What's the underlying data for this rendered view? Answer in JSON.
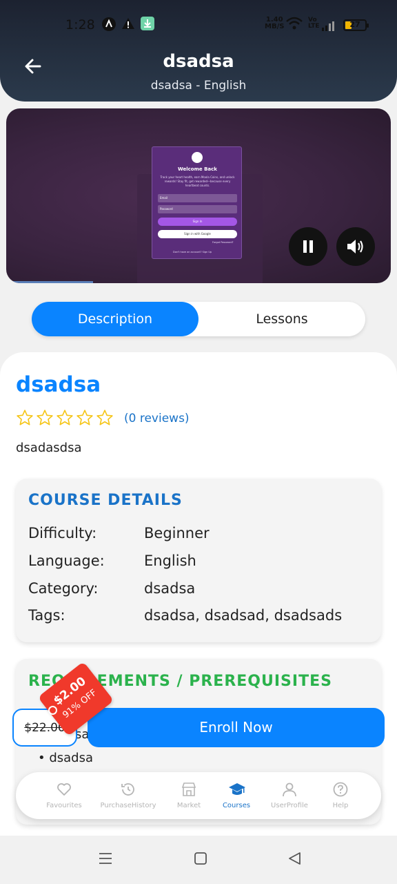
{
  "status_bar": {
    "time": "1:28",
    "net_speed_value": "1.40",
    "net_speed_unit": "MB/S",
    "volte_top": "Vo",
    "volte_bottom": "LTE",
    "battery": "27"
  },
  "header": {
    "title": "dsadsa",
    "subtitle": "dsadsa - English"
  },
  "video": {
    "modal_title": "Welcome Back",
    "modal_text": "Track your heart health, earn Moola Coins, and unlock rewards! Stay fit, get rewarded—because every heartbeat counts.",
    "email_placeholder": "Email",
    "password_placeholder": "Password",
    "sign_in": "Sign In",
    "google_sign_in": "Sign in with Google",
    "forgot": "Forgot Password?",
    "no_account": "Don't have an account?",
    "sign_up": "Sign Up"
  },
  "tabs": [
    {
      "label": "Description",
      "active": true
    },
    {
      "label": "Lessons",
      "active": false
    }
  ],
  "course": {
    "title": "dsadsa",
    "rating_stars": 0,
    "reviews": "(0 reviews)",
    "description": "dsadasdsa"
  },
  "details": {
    "heading": "COURSE DETAILS",
    "rows": [
      {
        "key": "Difficulty:",
        "value": "Beginner"
      },
      {
        "key": "Language:",
        "value": "English"
      },
      {
        "key": "Category:",
        "value": "dsadsa"
      },
      {
        "key": "Tags:",
        "value": "dsadsa, dsadsad, dsadsads"
      }
    ]
  },
  "requirements": {
    "heading": "REQUIREMENTS / PREREQUISITES",
    "partial_item": "sa",
    "item2": "• dsadsa"
  },
  "pricing": {
    "old_price": "$22.00",
    "new_price": "$2.00",
    "discount": "91% OFF",
    "enroll_label": "Enroll Now"
  },
  "bottom_nav": [
    {
      "label": "Favourites",
      "icon": "heart-icon",
      "active": false
    },
    {
      "label": "PurchaseHistory",
      "icon": "history-icon",
      "active": false
    },
    {
      "label": "Market",
      "icon": "store-icon",
      "active": false
    },
    {
      "label": "Courses",
      "icon": "graduation-cap-icon",
      "active": true
    },
    {
      "label": "UserProfile",
      "icon": "user-icon",
      "active": false
    },
    {
      "label": "Help",
      "icon": "help-icon",
      "active": false
    }
  ],
  "colors": {
    "accent": "#0a84ff",
    "header_bg": "#1c2230",
    "req_heading": "#2bb24c",
    "discount_tag": "#f0392b",
    "star": "#f5c518"
  }
}
